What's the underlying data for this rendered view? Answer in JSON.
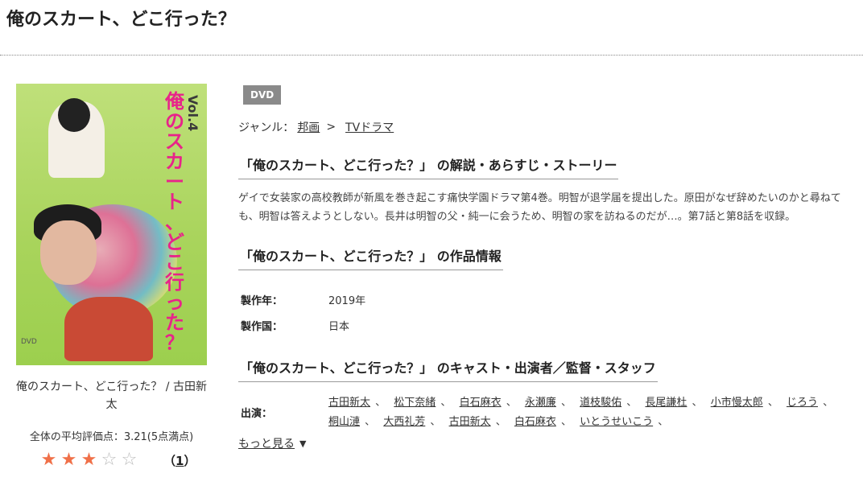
{
  "page": {
    "title": "俺のスカート、どこ行った？"
  },
  "cover": {
    "vertical_title": [
      "俺",
      "の",
      "ス",
      "カ",
      "ー",
      "ト",
      "、",
      "ど",
      "こ",
      "行",
      "っ",
      "た",
      "？"
    ],
    "volume": "Vol.4",
    "logo": "DVD"
  },
  "sidebar": {
    "caption": "俺のスカート、どこ行った？ / 古田新太",
    "avg_label": "全体の平均評価点：3.21(5点満点)",
    "stars_filled": 3,
    "stars_total": 5,
    "review_count_open": "（",
    "review_count": "1",
    "review_count_close": "）"
  },
  "main": {
    "badge": "DVD",
    "genre_label": "ジャンル：",
    "genre_1": "邦画",
    "genre_sep": ">",
    "genre_2": "TVドラマ",
    "synopsis_heading": "「俺のスカート、どこ行った？」 の解説・あらすじ・ストーリー",
    "synopsis": "ゲイで女装家の高校教師が新風を巻き起こす痛快学園ドラマ第4巻。明智が退学届を提出した。原田がなぜ辞めたいのかと尋ねても、明智は答えようとしない。長井は明智の父・純一に会うため、明智の家を訪ねるのだが…。第7話と第8話を収録。",
    "info_heading": "「俺のスカート、どこ行った？」 の作品情報",
    "info": [
      {
        "key": "製作年：",
        "value": "2019年"
      },
      {
        "key": "製作国：",
        "value": "日本"
      }
    ],
    "cast_heading": "「俺のスカート、どこ行った？」 のキャスト・出演者／監督・スタッフ",
    "cast_label": "出演：",
    "cast": [
      "古田新太",
      "松下奈緒",
      "白石麻衣",
      "永瀬廉",
      "道枝駿佑",
      "長尾謙杜",
      "小市慢太郎",
      "じろう",
      "桐山漣",
      "大西礼芳",
      "古田新太",
      "白石麻衣",
      "いとうせいこう"
    ],
    "cast_sep": "、",
    "more_label": "もっと見る",
    "more_icon": "chevron-down-icon"
  },
  "colors": {
    "star_on": "#f07048",
    "star_off": "#bbbbbb",
    "badge_bg": "#8a8a8a",
    "cover_pink": "#e8238a",
    "cover_green": "#a9d45c"
  }
}
